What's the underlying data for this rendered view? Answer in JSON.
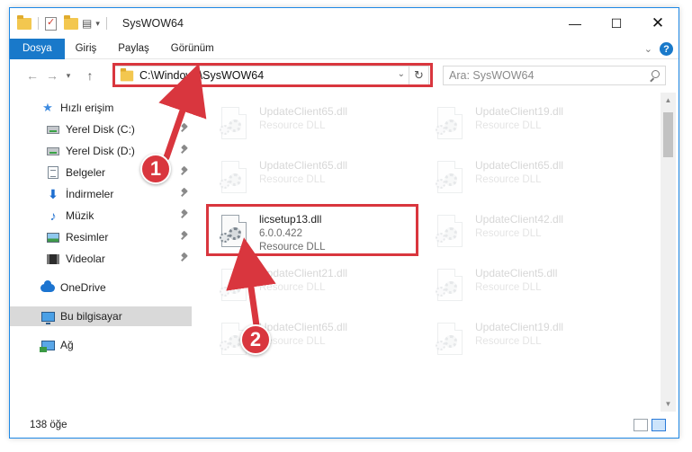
{
  "window": {
    "title": "SysWOW64",
    "controls": {
      "minimize": "—",
      "maximize": "☐",
      "close": "✕"
    }
  },
  "ribbon": {
    "tabs": [
      "Dosya",
      "Giriş",
      "Paylaş",
      "Görünüm"
    ],
    "active_tab": "Dosya",
    "help_label": "?"
  },
  "navbar": {
    "address": "C:\\Windows\\SysWOW64",
    "search_placeholder": "Ara: SysWOW64"
  },
  "sidebar": {
    "items": [
      {
        "label": "Hızlı erişim",
        "icon": "star-icon"
      },
      {
        "label": "Yerel Disk (C:)",
        "icon": "drive-icon",
        "pinned": true
      },
      {
        "label": "Yerel Disk (D:)",
        "icon": "drive-icon",
        "pinned": true
      },
      {
        "label": "Belgeler",
        "icon": "documents-icon",
        "pinned": true
      },
      {
        "label": "İndirmeler",
        "icon": "downloads-icon",
        "pinned": true
      },
      {
        "label": "Müzik",
        "icon": "music-icon",
        "pinned": true
      },
      {
        "label": "Resimler",
        "icon": "pictures-icon",
        "pinned": true
      },
      {
        "label": "Videolar",
        "icon": "videos-icon",
        "pinned": true
      },
      {
        "label": "OneDrive",
        "icon": "onedrive-icon"
      },
      {
        "label": "Bu bilgisayar",
        "icon": "this-pc-icon",
        "selected": true
      },
      {
        "label": "Ağ",
        "icon": "network-icon"
      }
    ]
  },
  "files": {
    "background": [
      {
        "name": "UpdateClient65.dll",
        "type": "Resource DLL"
      },
      {
        "name": "UpdateClient19.dll",
        "type": "Resource DLL"
      },
      {
        "name": "UpdateClient65.dll",
        "type": "Resource DLL"
      },
      {
        "name": "UpdateClient65.dll",
        "type": "Resource DLL"
      },
      {
        "name": "UpdateClient42.dll",
        "type": "Resource DLL"
      },
      {
        "name": "UpdateClient21.dll",
        "type": "Resource DLL"
      },
      {
        "name": "UpdateClient5.dll",
        "type": "Resource DLL"
      },
      {
        "name": "UpdateClient65.dll",
        "type": "Resource DLL"
      },
      {
        "name": "UpdateClient19.dll",
        "type": "Resource DLL"
      }
    ],
    "highlighted": {
      "name": "licsetup13.dll",
      "version": "6.0.0.422",
      "type": "Resource DLL"
    }
  },
  "status": {
    "item_count": "138 öğe"
  },
  "annotations": {
    "step1": "1",
    "step2": "2",
    "accent_color": "#d9363e"
  }
}
